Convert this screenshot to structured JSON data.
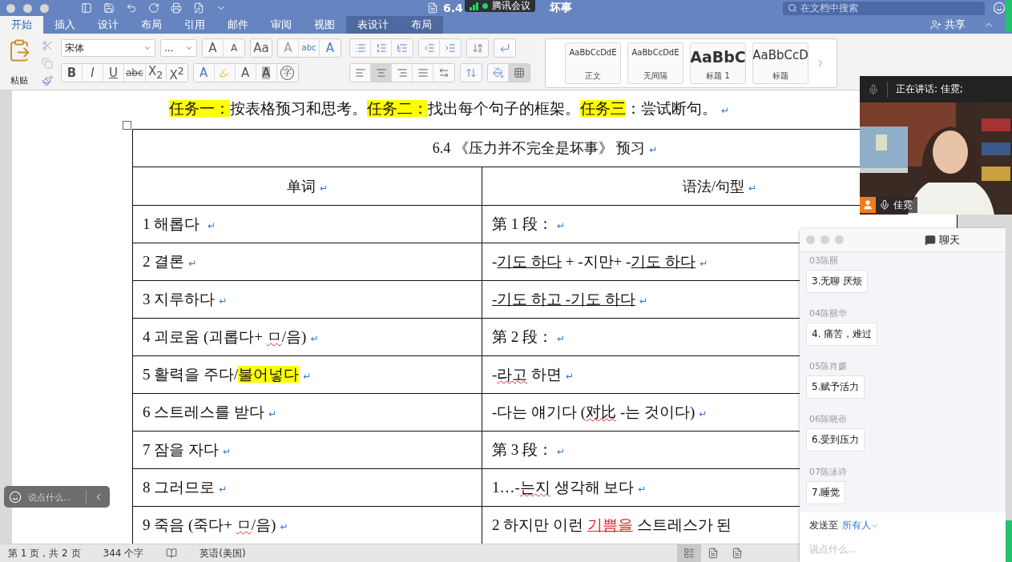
{
  "title_bar": {
    "title_start": "6.4",
    "title_end": "坏事",
    "search_placeholder": "在文档中搜索"
  },
  "meeting_badge": {
    "label": "腾讯会议"
  },
  "tabs": [
    {
      "label": "开始",
      "selected": true,
      "contextual": false
    },
    {
      "label": "插入",
      "selected": false,
      "contextual": false
    },
    {
      "label": "设计",
      "selected": false,
      "contextual": false
    },
    {
      "label": "布局",
      "selected": false,
      "contextual": false
    },
    {
      "label": "引用",
      "selected": false,
      "contextual": false
    },
    {
      "label": "邮件",
      "selected": false,
      "contextual": false
    },
    {
      "label": "审阅",
      "selected": false,
      "contextual": false
    },
    {
      "label": "视图",
      "selected": false,
      "contextual": false
    },
    {
      "label": "表设计",
      "selected": false,
      "contextual": true
    },
    {
      "label": "布局",
      "selected": false,
      "contextual": true
    }
  ],
  "share": {
    "label": "共享"
  },
  "ribbon": {
    "paste_label": "粘贴",
    "font_name": "宋体",
    "font_size": "...",
    "font_buttons": [
      {
        "kind": "grow",
        "label": "A"
      },
      {
        "kind": "shrink",
        "label": "A"
      },
      {
        "kind": "case",
        "label": "Aa"
      },
      {
        "kind": "clear",
        "label": "A"
      },
      {
        "kind": "phonetic",
        "label": "abc"
      },
      {
        "kind": "border",
        "label": "A"
      }
    ],
    "format_buttons": [
      {
        "kind": "bold",
        "label": "B"
      },
      {
        "kind": "italic",
        "label": "I"
      },
      {
        "kind": "underline",
        "label": "U"
      },
      {
        "kind": "strike",
        "label": "abc"
      },
      {
        "kind": "sub",
        "label": "X$_{2}$"
      },
      {
        "kind": "sup",
        "label": "X$^{2}$"
      },
      {
        "kind": "effect",
        "label": "A"
      },
      {
        "kind": "highlight"
      },
      {
        "kind": "color",
        "label": "A"
      },
      {
        "kind": "shading",
        "label": "A"
      },
      {
        "kind": "enclose",
        "label": "字"
      }
    ],
    "align_buttons": [
      {
        "kind": "left",
        "selected": false
      },
      {
        "kind": "center",
        "selected": true
      },
      {
        "kind": "right",
        "selected": false
      },
      {
        "kind": "justify",
        "selected": false
      },
      {
        "kind": "distributed",
        "selected": false
      }
    ],
    "styles": [
      {
        "sample": "AaBbCcDdE",
        "name": "正文",
        "kind": "body"
      },
      {
        "sample": "AaBbCcDdE",
        "name": "无间隔",
        "kind": "body"
      },
      {
        "sample": "AaBbC",
        "name": "标题 1",
        "kind": "heading"
      },
      {
        "sample": "AaBbCcD",
        "name": "标题",
        "kind": "subheading"
      }
    ]
  },
  "document": {
    "intro": [
      {
        "text": "任务一：",
        "kind": "highlight"
      },
      {
        "text": "按表格预习和思考。",
        "kind": "plain"
      },
      {
        "text": "任务二：",
        "kind": "highlight"
      },
      {
        "text": "找出每个句子的框架。",
        "kind": "plain"
      },
      {
        "text": "任务三",
        "kind": "highlight"
      },
      {
        "text": "：尝试断句。",
        "kind": "plain"
      },
      {
        "text": "↵",
        "kind": "mark"
      }
    ],
    "table": {
      "title": [
        {
          "text": "6.4 《压力并不完全是坏事》 预习",
          "kind": "plain"
        },
        {
          "text": "↵",
          "kind": "mark"
        }
      ],
      "columns": [
        [
          {
            "text": "单词",
            "kind": "plain"
          },
          {
            "text": "↵",
            "kind": "mark"
          }
        ],
        [
          {
            "text": "语法/句型",
            "kind": "plain"
          },
          {
            "text": "↵",
            "kind": "mark"
          }
        ]
      ],
      "rows": [
        [
          [
            {
              "text": "1 해롭다  ",
              "kind": "plain"
            },
            {
              "text": "↵",
              "kind": "mark"
            }
          ],
          [
            {
              "text": "第 1 段：",
              "kind": "plain"
            },
            {
              "text": "↵",
              "kind": "mark"
            }
          ]
        ],
        [
          [
            {
              "text": "2 결론",
              "kind": "plain"
            },
            {
              "text": "↵",
              "kind": "mark"
            }
          ],
          [
            {
              "text": "-",
              "kind": "plain"
            },
            {
              "text": "기도 하다",
              "kind": "underline"
            },
            {
              "text": " + -지만+ -",
              "kind": "plain"
            },
            {
              "text": "기도 하다",
              "kind": "underline"
            },
            {
              "text": "↵",
              "kind": "mark"
            }
          ]
        ],
        [
          [
            {
              "text": "3 지루하다",
              "kind": "plain"
            },
            {
              "text": "↵",
              "kind": "mark"
            }
          ],
          [
            {
              "text": "-기도 하고 -기도 하다",
              "kind": "underline"
            },
            {
              "text": "↵",
              "kind": "mark"
            }
          ]
        ],
        [
          [
            {
              "text": "4 괴로움 (괴롭다+ ",
              "kind": "plain"
            },
            {
              "text": "ㅁ",
              "kind": "wavy"
            },
            {
              "text": "/음)",
              "kind": "plain"
            },
            {
              "text": "↵",
              "kind": "mark"
            }
          ],
          [
            {
              "text": "第 2 段：",
              "kind": "plain"
            },
            {
              "text": "↵",
              "kind": "mark"
            }
          ]
        ],
        [
          [
            {
              "text": "5 활력을 주다/",
              "kind": "plain"
            },
            {
              "text": "불어넣다",
              "kind": "highlight"
            },
            {
              "text": "↵",
              "kind": "mark"
            }
          ],
          [
            {
              "text": "-",
              "kind": "plain"
            },
            {
              "text": "라고",
              "kind": "wavy"
            },
            {
              "text": " 하면",
              "kind": "plain"
            },
            {
              "text": "↵",
              "kind": "mark"
            }
          ]
        ],
        [
          [
            {
              "text": "6 스트레스를 받다",
              "kind": "plain"
            },
            {
              "text": "↵",
              "kind": "mark"
            }
          ],
          [
            {
              "text": "-다는 얘기다 (",
              "kind": "plain"
            },
            {
              "text": "对比",
              "kind": "wavy"
            },
            {
              "text": "  -는 것이다)",
              "kind": "plain"
            },
            {
              "text": "↵",
              "kind": "mark"
            }
          ]
        ],
        [
          [
            {
              "text": "7 잠을 자다",
              "kind": "plain"
            },
            {
              "text": "↵",
              "kind": "mark"
            }
          ],
          [
            {
              "text": "第 3 段：",
              "kind": "plain"
            },
            {
              "text": "↵",
              "kind": "mark"
            }
          ]
        ],
        [
          [
            {
              "text": "8 그러므로",
              "kind": "plain"
            },
            {
              "text": "↵",
              "kind": "mark"
            }
          ],
          [
            {
              "text": "1…-",
              "kind": "plain"
            },
            {
              "text": "는지",
              "kind": "wavy"
            },
            {
              "text": " 생각해 보다",
              "kind": "plain"
            },
            {
              "text": "↵",
              "kind": "mark"
            }
          ]
        ],
        [
          [
            {
              "text": "9 죽음 (죽다+ ",
              "kind": "plain"
            },
            {
              "text": "ㅁ",
              "kind": "wavy"
            },
            {
              "text": "/음)",
              "kind": "plain"
            },
            {
              "text": "↵",
              "kind": "mark"
            }
          ],
          [
            {
              "text": "2 하지만 이런 ",
              "kind": "plain"
            },
            {
              "text": "기쁨을",
              "kind": "red-underline"
            },
            {
              "text": " 스트레스가 된",
              "kind": "plain"
            }
          ]
        ]
      ]
    }
  },
  "status_bar": {
    "pages": "第 1 页，共 2 页",
    "words": "344 个字",
    "language": "英语(美国)",
    "views": [
      {
        "selected": true
      },
      {
        "selected": false
      },
      {
        "selected": false
      }
    ]
  },
  "floating_input": {
    "placeholder": "说点什么..."
  },
  "video": {
    "speaking": "正在讲话: 佳霓;",
    "name": "佳霓"
  },
  "chat": {
    "title": "聊天",
    "messages": [
      {
        "sender": "03陈丽",
        "text": "3.无聊 厌烦"
      },
      {
        "sender": "04陈丽华",
        "text": "4. 痛苦，难过"
      },
      {
        "sender": "05陈肖媛",
        "text": "5.赋予活力"
      },
      {
        "sender": "06陈晓蓓",
        "text": "6.受到压力"
      },
      {
        "sender": "07陈泳诗",
        "text": "7.睡觉"
      }
    ],
    "send_to_label": "发送至",
    "recipient": "所有人",
    "placeholder": "说点什么..."
  }
}
